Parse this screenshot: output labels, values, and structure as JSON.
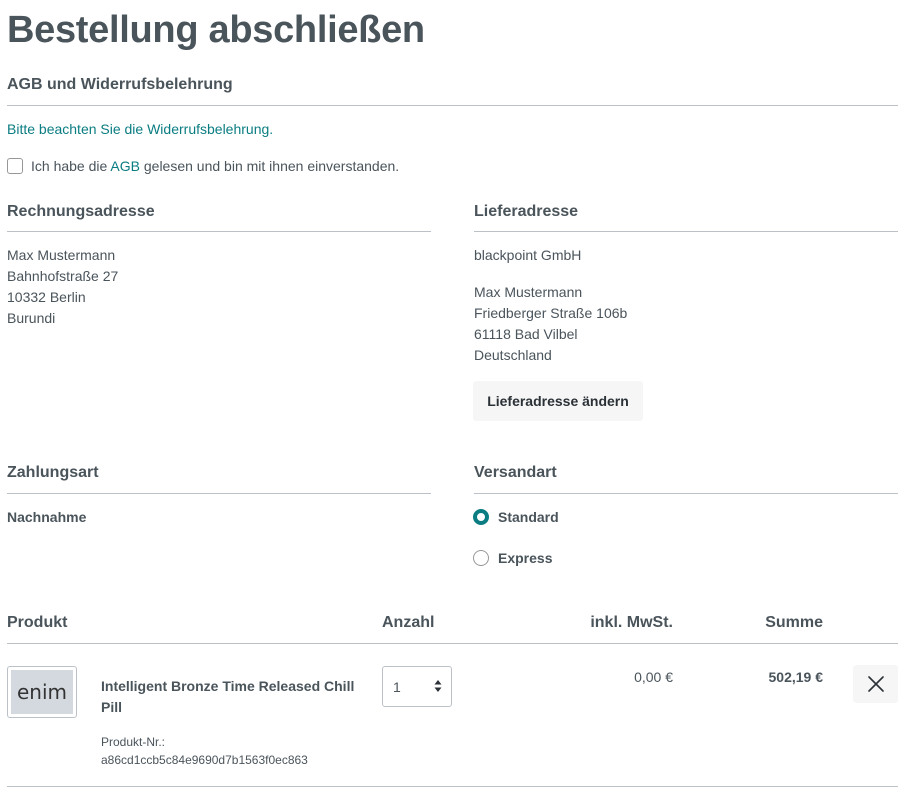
{
  "page": {
    "title": "Bestellung abschließen"
  },
  "tos": {
    "section_title": "AGB und Widerrufsbelehrung",
    "revocation_text": "Bitte beachten Sie die Widerrufsbelehrung.",
    "checkbox_prefix": "Ich habe die ",
    "checkbox_link": "AGB",
    "checkbox_suffix": " gelesen und bin mit ihnen einverstanden.",
    "checked": false
  },
  "billing": {
    "title": "Rechnungsadresse",
    "lines": [
      "Max Mustermann",
      "Bahnhofstraße 27",
      "10332 Berlin",
      "Burundi"
    ]
  },
  "shipping": {
    "title": "Lieferadresse",
    "company": "blackpoint GmbH",
    "lines": [
      "Max Mustermann",
      "Friedberger Straße 106b",
      "61118 Bad Vilbel",
      "Deutschland"
    ],
    "change_button": "Lieferadresse ändern"
  },
  "payment": {
    "title": "Zahlungsart",
    "selected": "Nachnahme"
  },
  "shipping_method": {
    "title": "Versandart",
    "options": [
      {
        "label": "Standard",
        "checked": true
      },
      {
        "label": "Express",
        "checked": false
      }
    ]
  },
  "cart": {
    "headers": {
      "product": "Produkt",
      "quantity": "Anzahl",
      "tax": "inkl. MwSt.",
      "total": "Summe"
    },
    "items": [
      {
        "thumb_text": "enim",
        "name": "Intelligent Bronze Time Released Chill Pill",
        "number_label": "Produkt-Nr.:",
        "number": "a86cd1ccb5c84e9690d7b1563f0ec863",
        "quantity": "1",
        "tax": "0,00 €",
        "total": "502,19 €",
        "remove_icon": "close-icon"
      }
    ]
  },
  "colors": {
    "accent": "#0b7d82",
    "text": "#4a545b",
    "rule": "#bcc1c7",
    "button_bg": "#f6f6f6"
  }
}
